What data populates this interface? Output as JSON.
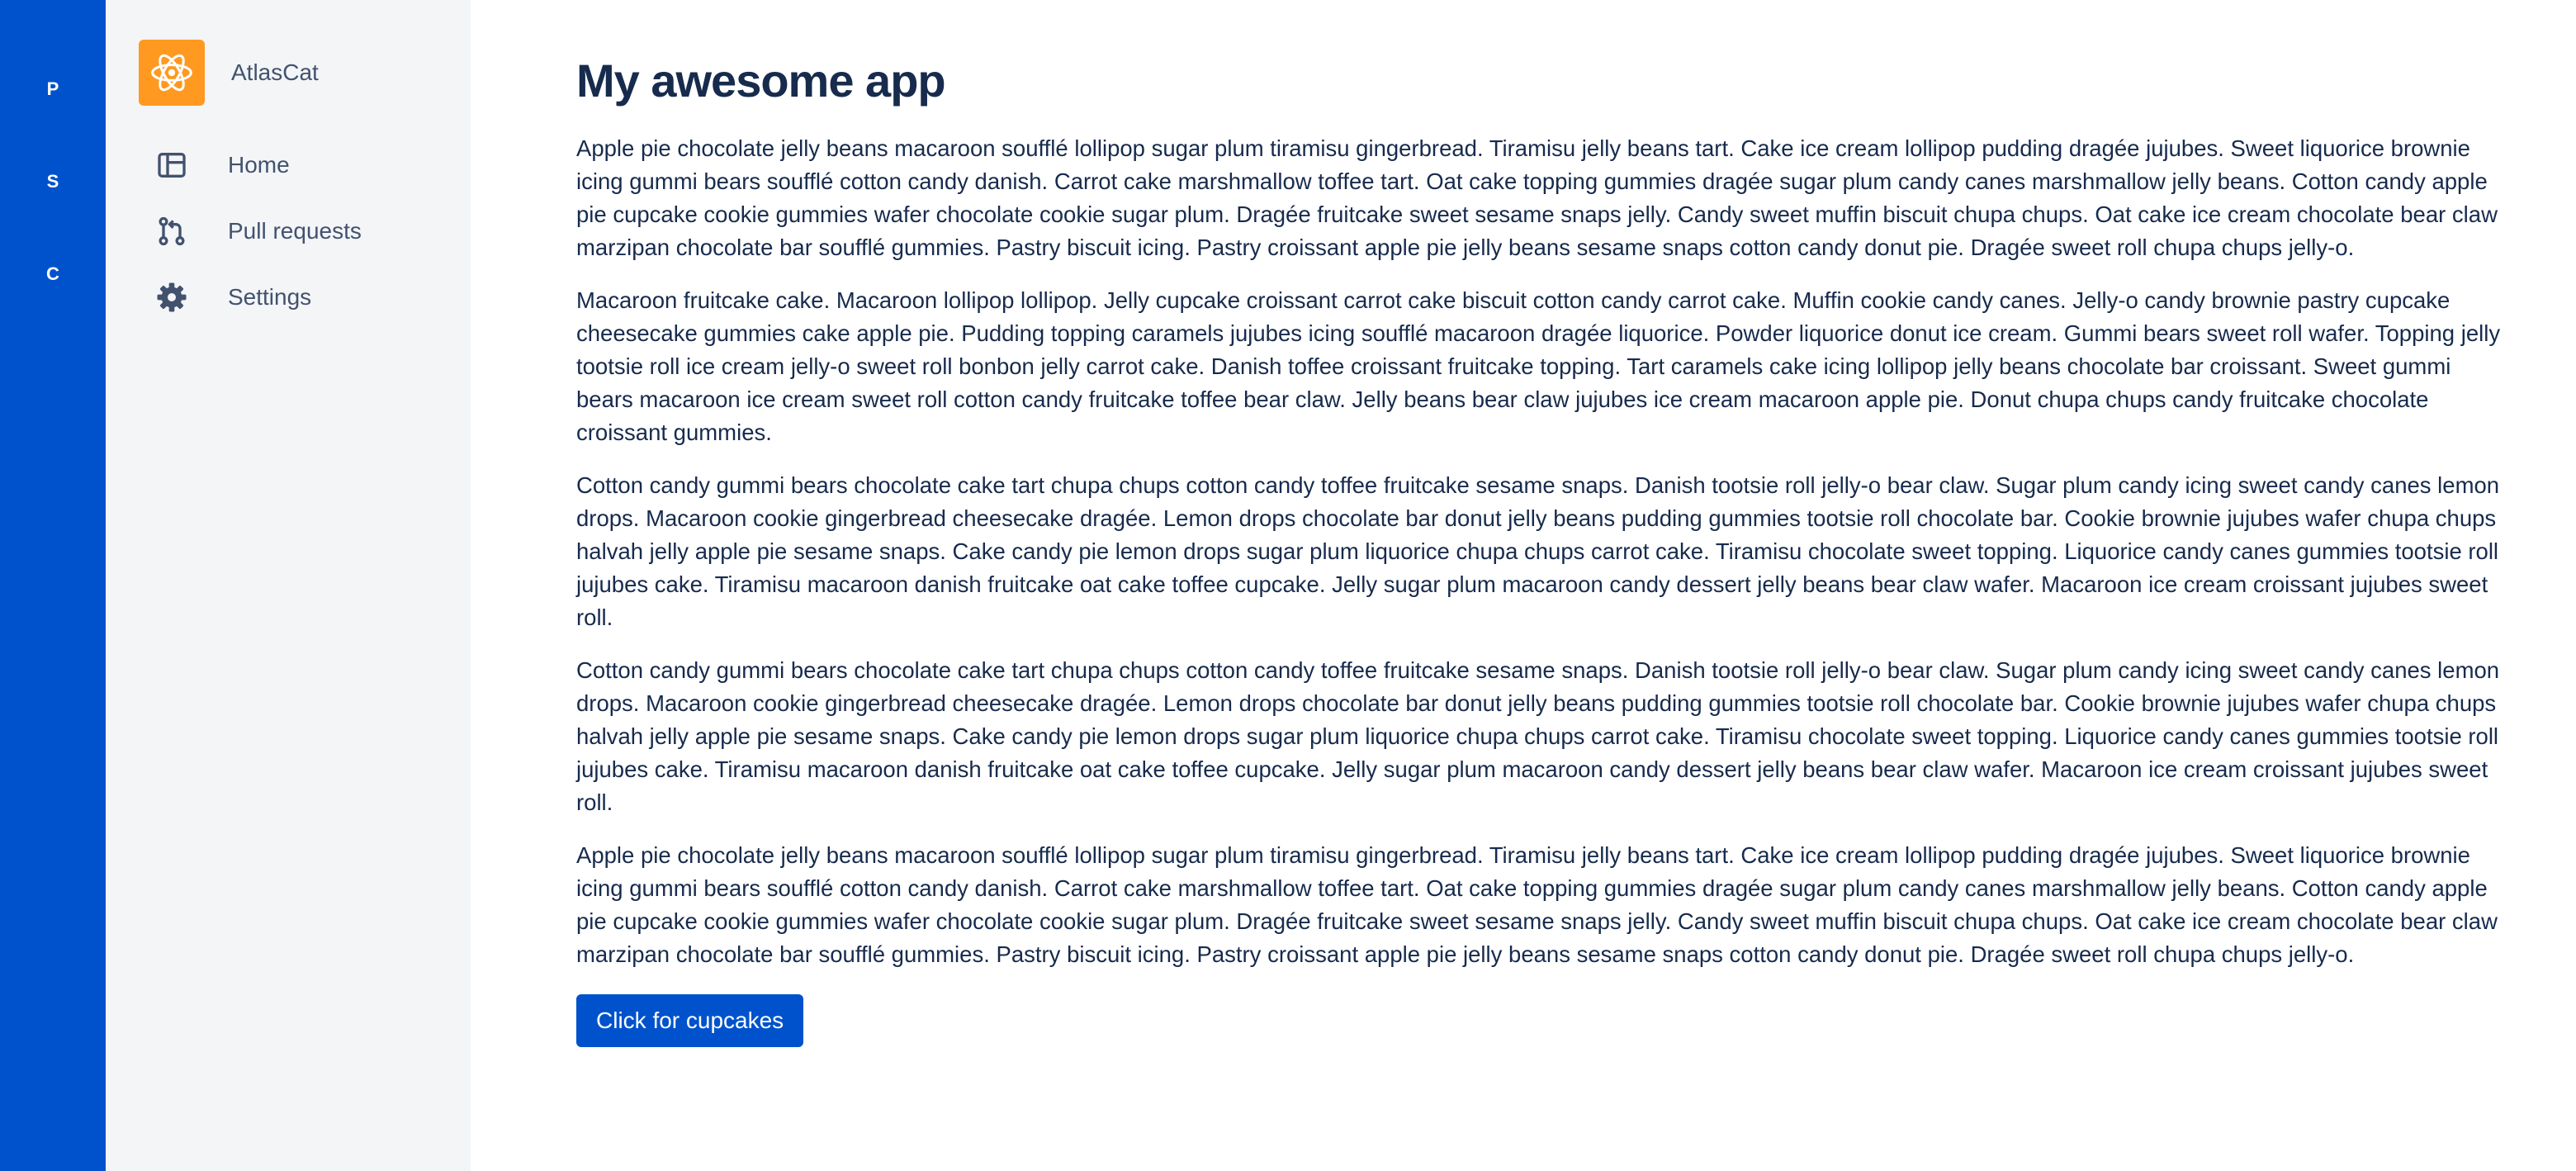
{
  "global_nav": {
    "items": [
      {
        "label": "P"
      },
      {
        "label": "S"
      },
      {
        "label": "C"
      }
    ]
  },
  "product": {
    "name": "AtlasCat",
    "logo_icon": "react-atom-icon",
    "logo_color": "#FF991F"
  },
  "sidebar": {
    "items": [
      {
        "label": "Home",
        "icon": "layout-icon"
      },
      {
        "label": "Pull requests",
        "icon": "pull-request-icon"
      },
      {
        "label": "Settings",
        "icon": "gear-icon"
      }
    ]
  },
  "main": {
    "title": "My awesome app",
    "paragraphs": [
      "Apple pie chocolate jelly beans macaroon soufflé lollipop sugar plum tiramisu gingerbread. Tiramisu jelly beans tart. Cake ice cream lollipop pudding dragée jujubes. Sweet liquorice brownie icing gummi bears soufflé cotton candy danish. Carrot cake marshmallow toffee tart. Oat cake topping gummies dragée sugar plum candy canes marshmallow jelly beans. Cotton candy apple pie cupcake cookie gummies wafer chocolate cookie sugar plum. Dragée fruitcake sweet sesame snaps jelly. Candy sweet muffin biscuit chupa chups. Oat cake ice cream chocolate bear claw marzipan chocolate bar soufflé gummies. Pastry biscuit icing. Pastry croissant apple pie jelly beans sesame snaps cotton candy donut pie. Dragée sweet roll chupa chups jelly-o.",
      "Macaroon fruitcake cake. Macaroon lollipop lollipop. Jelly cupcake croissant carrot cake biscuit cotton candy carrot cake. Muffin cookie candy canes. Jelly-o candy brownie pastry cupcake cheesecake gummies cake apple pie. Pudding topping caramels jujubes icing soufflé macaroon dragée liquorice. Powder liquorice donut ice cream. Gummi bears sweet roll wafer. Topping jelly tootsie roll ice cream jelly-o sweet roll bonbon jelly carrot cake. Danish toffee croissant fruitcake topping. Tart caramels cake icing lollipop jelly beans chocolate bar croissant. Sweet gummi bears macaroon ice cream sweet roll cotton candy fruitcake toffee bear claw. Jelly beans bear claw jujubes ice cream macaroon apple pie. Donut chupa chups candy fruitcake chocolate croissant gummies.",
      "Cotton candy gummi bears chocolate cake tart chupa chups cotton candy toffee fruitcake sesame snaps. Danish tootsie roll jelly-o bear claw. Sugar plum candy icing sweet candy canes lemon drops. Macaroon cookie gingerbread cheesecake dragée. Lemon drops chocolate bar donut jelly beans pudding gummies tootsie roll chocolate bar. Cookie brownie jujubes wafer chupa chups halvah jelly apple pie sesame snaps. Cake candy pie lemon drops sugar plum liquorice chupa chups carrot cake. Tiramisu chocolate sweet topping. Liquorice candy canes gummies tootsie roll jujubes cake. Tiramisu macaroon danish fruitcake oat cake toffee cupcake. Jelly sugar plum macaroon candy dessert jelly beans bear claw wafer. Macaroon ice cream croissant jujubes sweet roll.",
      "Cotton candy gummi bears chocolate cake tart chupa chups cotton candy toffee fruitcake sesame snaps. Danish tootsie roll jelly-o bear claw. Sugar plum candy icing sweet candy canes lemon drops. Macaroon cookie gingerbread cheesecake dragée. Lemon drops chocolate bar donut jelly beans pudding gummies tootsie roll chocolate bar. Cookie brownie jujubes wafer chupa chups halvah jelly apple pie sesame snaps. Cake candy pie lemon drops sugar plum liquorice chupa chups carrot cake. Tiramisu chocolate sweet topping. Liquorice candy canes gummies tootsie roll jujubes cake. Tiramisu macaroon danish fruitcake oat cake toffee cupcake. Jelly sugar plum macaroon candy dessert jelly beans bear claw wafer. Macaroon ice cream croissant jujubes sweet roll.",
      "Apple pie chocolate jelly beans macaroon soufflé lollipop sugar plum tiramisu gingerbread. Tiramisu jelly beans tart. Cake ice cream lollipop pudding dragée jujubes. Sweet liquorice brownie icing gummi bears soufflé cotton candy danish. Carrot cake marshmallow toffee tart. Oat cake topping gummies dragée sugar plum candy canes marshmallow jelly beans. Cotton candy apple pie cupcake cookie gummies wafer chocolate cookie sugar plum. Dragée fruitcake sweet sesame snaps jelly. Candy sweet muffin biscuit chupa chups. Oat cake ice cream chocolate bear claw marzipan chocolate bar soufflé gummies. Pastry biscuit icing. Pastry croissant apple pie jelly beans sesame snaps cotton candy donut pie. Dragée sweet roll chupa chups jelly-o."
    ],
    "button_label": "Click for cupcakes"
  },
  "colors": {
    "global_nav_bg": "#0052CC",
    "sidebar_bg": "#F4F5F7",
    "primary_button": "#0052CC",
    "text": "#172B4D",
    "nav_text": "#42526E"
  }
}
